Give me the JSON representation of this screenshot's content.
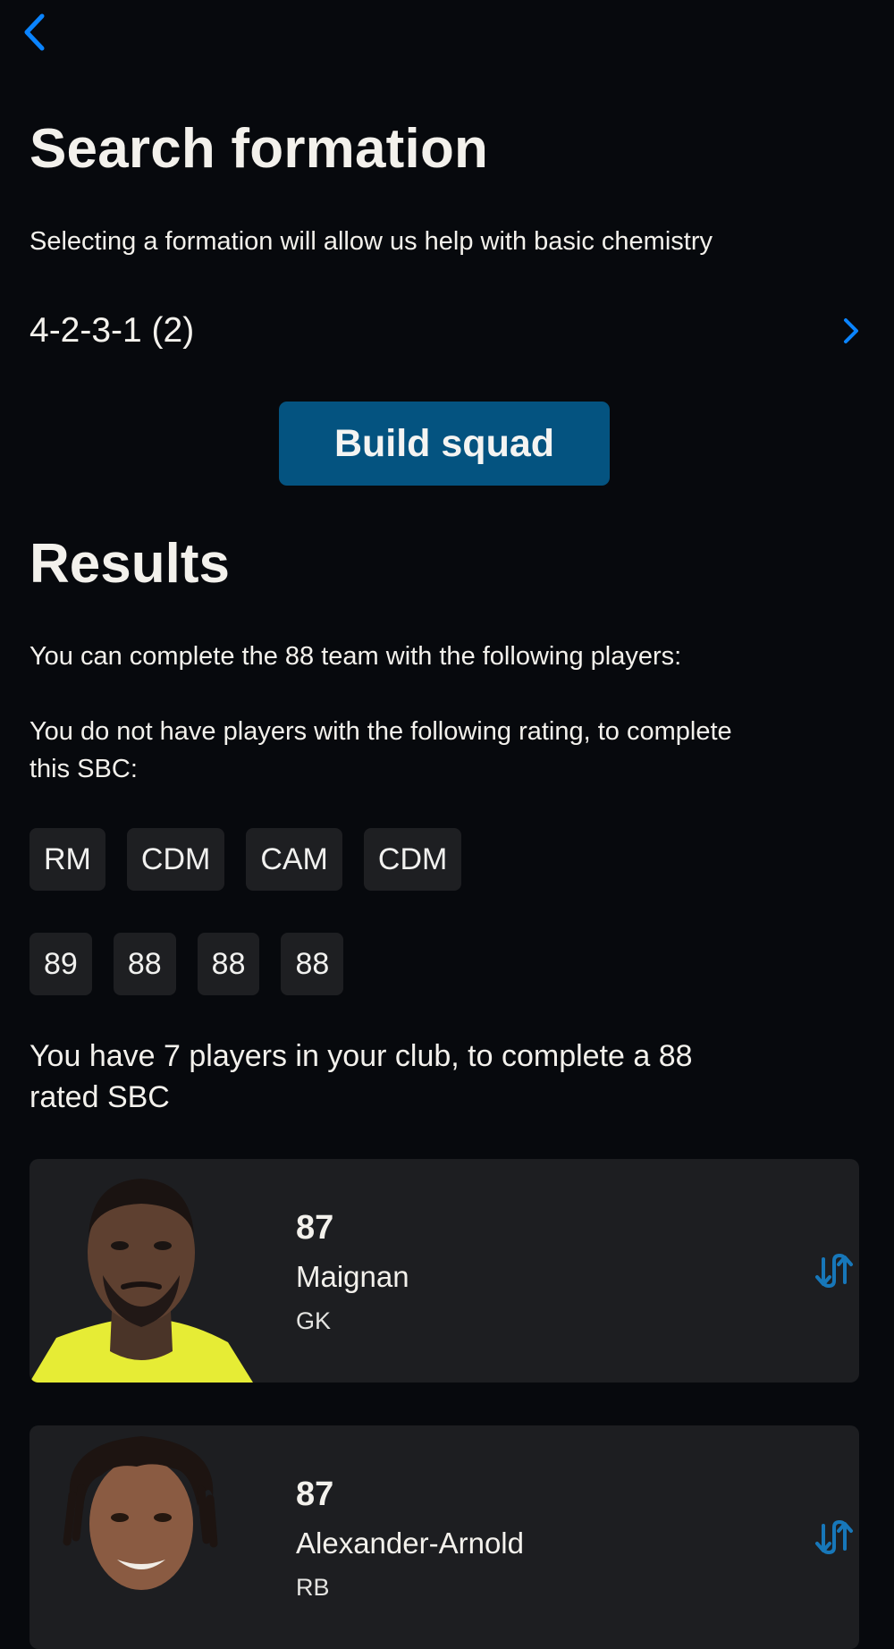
{
  "nav": {
    "back_icon": "chevron-left-icon"
  },
  "header": {
    "title": "Search formation",
    "subtitle": "Selecting a formation will allow us help with basic chemistry"
  },
  "formation": {
    "value": "4-2-3-1 (2)",
    "chevron_icon": "chevron-right-icon"
  },
  "actions": {
    "build_label": "Build squad"
  },
  "results": {
    "title": "Results",
    "complete_text": "You can complete the 88 team with the following players:",
    "missing_text_line1": "You do not have players with the following rating, to complete",
    "missing_text_line2": "this SBC:",
    "positions": [
      "RM",
      "CDM",
      "CAM",
      "CDM"
    ],
    "ratings": [
      "89",
      "88",
      "88",
      "88"
    ],
    "club_text_line1": "You have 7 players in your club, to complete a 88",
    "club_text_line2": "rated SBC"
  },
  "players": [
    {
      "rating": "87",
      "name": "Maignan",
      "position": "GK",
      "swap_icon": "swap-icon"
    },
    {
      "rating": "87",
      "name": "Alexander-Arnold",
      "position": "RB",
      "swap_icon": "swap-icon"
    }
  ],
  "colors": {
    "background": "#07090d",
    "accent": "#0a84ff",
    "button": "#045380",
    "card": "#1d1e21",
    "chip": "#1e1f22"
  }
}
